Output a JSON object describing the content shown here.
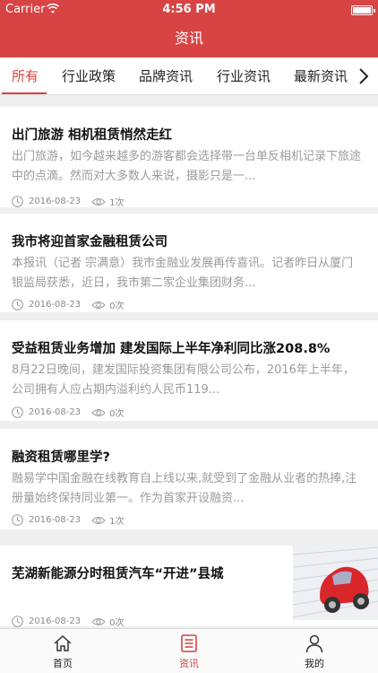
{
  "status_bar": {
    "carrier": "Carrier",
    "time": "4:56 PM"
  },
  "header": {
    "title": "资讯"
  },
  "tabs": [
    {
      "label": "所有",
      "active": true
    },
    {
      "label": "行业政策",
      "active": false
    },
    {
      "label": "品牌资讯",
      "active": false
    },
    {
      "label": "行业资讯",
      "active": false
    },
    {
      "label": "最新资讯",
      "active": false
    }
  ],
  "articles": [
    {
      "title": "出门旅游 相机租赁悄然走红",
      "summary": "出门旅游，如今越来越多的游客都会选择带一台单反相机记录下旅途中的点滴。然而对大多数人来说，摄影只是一...",
      "date": "2016-08-23",
      "views": "1次"
    },
    {
      "title": "我市将迎首家金融租赁公司",
      "summary": "本报讯（记者 宗满意）我市金融业发展再传喜讯。记者昨日从厦门银监局获悉，近日，我市第二家企业集团财务...",
      "date": "2016-08-23",
      "views": "0次"
    },
    {
      "title": "受益租赁业务增加 建发国际上半年净利同比涨208.8%",
      "summary": "8月22日晚间，建发国际投资集团有限公司公布，2016年上半年，公司拥有人应占期内溢利约人民币119...",
      "date": "2016-08-23",
      "views": "0次"
    },
    {
      "title": "融资租赁哪里学?",
      "summary": "融易学中国金融在线教育自上线以来,就受到了金融从业者的热捧,注册量始终保持同业第一。作为首家开设融资...",
      "date": "2016-08-23",
      "views": "1次"
    },
    {
      "title": "芜湖新能源分时租赁汽车“开进”县城",
      "summary": "",
      "date": "2016-08-23",
      "views": "0次",
      "thumbnail": "red-toy-car-on-keyboard"
    }
  ],
  "bottom_nav": [
    {
      "label": "首页",
      "icon": "home-icon",
      "active": false
    },
    {
      "label": "资讯",
      "icon": "news-icon",
      "active": true
    },
    {
      "label": "我的",
      "icon": "person-icon",
      "active": false
    }
  ],
  "colors": {
    "brand": "#d84343",
    "background": "#efefef",
    "muted_text": "#9b9b9b"
  }
}
